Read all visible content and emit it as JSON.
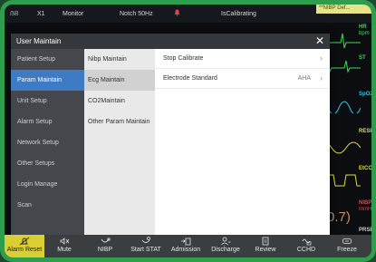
{
  "status_bar": {
    "bed": "ẞB",
    "pid": "X1",
    "mode": "Monitor",
    "notch": "Notch 50Hz",
    "status": "IsCalibrating",
    "nibp_alert": "**NIBP Def..."
  },
  "dialog": {
    "title": "User Maintain",
    "close_glyph": "✕",
    "menu": [
      {
        "label": "Patient Setup"
      },
      {
        "label": "Param Maintain"
      },
      {
        "label": "Unit Setup"
      },
      {
        "label": "Alarm Setup"
      },
      {
        "label": "Network Setup"
      },
      {
        "label": "Other Setups"
      },
      {
        "label": "Login Manage"
      },
      {
        "label": "Scan"
      }
    ],
    "submenu": [
      {
        "label": "Nibp Maintain"
      },
      {
        "label": "Ecg Maintain"
      },
      {
        "label": "CO2Maintain"
      },
      {
        "label": "Other Param Maintain"
      }
    ],
    "settings": [
      {
        "label": "Stop Calibrate",
        "value": ""
      },
      {
        "label": "Electrode Standard",
        "value": "AHA"
      }
    ]
  },
  "background_params": {
    "hr_label": "HR",
    "hr_unit": "bpm",
    "st_label": "ST",
    "spo2_label": "SpO2",
    "resp_label": "RESP",
    "etco2_label": "EtCO",
    "nibp_label": "NIBP",
    "nibp_unit": "mmHg",
    "nibp_value": "0.7)",
    "prs_label": "PRSE"
  },
  "toolbar": [
    {
      "label": "Alarm Reset",
      "icon": "alarm-reset-icon"
    },
    {
      "label": "Mute",
      "icon": "mute-icon"
    },
    {
      "label": "NIBP",
      "icon": "nibp-icon"
    },
    {
      "label": "Start STAT",
      "icon": "start-stat-icon"
    },
    {
      "label": "Admission",
      "icon": "admission-icon"
    },
    {
      "label": "Discharge",
      "icon": "discharge-icon"
    },
    {
      "label": "Review",
      "icon": "review-icon"
    },
    {
      "label": "CCHD",
      "icon": "cchd-icon"
    },
    {
      "label": "Freeze",
      "icon": "freeze-icon"
    }
  ],
  "colors": {
    "frame": "#2f9e4c",
    "menu_selected": "#3f7bc5",
    "alarm_reset_bg": "#d9cf33",
    "wave_green": "#3fdc56",
    "wave_yellow": "#e3dd3c",
    "wave_cyan": "#31c6e0",
    "wave_red": "#e14444"
  }
}
